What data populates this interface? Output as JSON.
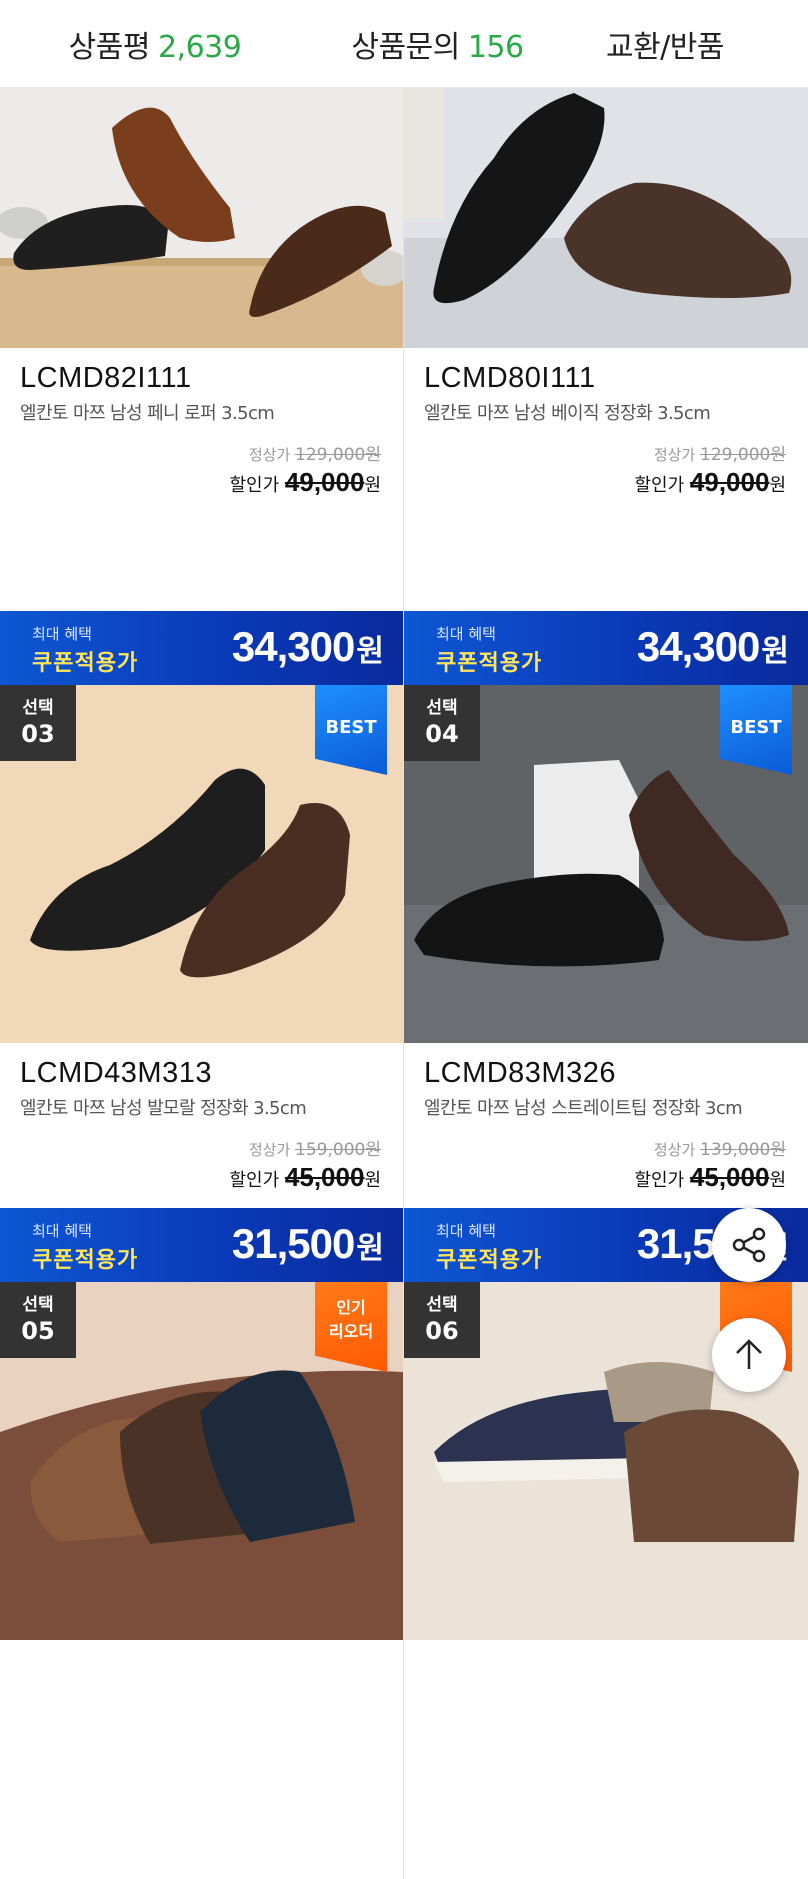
{
  "tabs": [
    {
      "label": "상품평",
      "count": "2,639"
    },
    {
      "label": "상품문의",
      "count": "156"
    },
    {
      "label": "교환/반품",
      "count": ""
    }
  ],
  "coupon_common": {
    "small": "최대 혜택",
    "label": "쿠폰적용가"
  },
  "products": [
    {
      "code": "LCMD82I111",
      "desc": "엘칸토 마쯔 남성 페니 로퍼 3.5cm",
      "orig_label": "정상가",
      "orig_price": "129,000",
      "orig_unit": "원",
      "sale_label": "할인가",
      "sale_price": "49,000",
      "sale_unit": "원",
      "coupon_price": "34,300",
      "coupon_unit": "원"
    },
    {
      "code": "LCMD80I111",
      "desc": "엘칸토 마쯔 남성 베이직 정장화 3.5cm",
      "orig_label": "정상가",
      "orig_price": "129,000",
      "orig_unit": "원",
      "sale_label": "할인가",
      "sale_price": "49,000",
      "sale_unit": "원",
      "coupon_price": "34,300",
      "coupon_unit": "원"
    },
    {
      "choice_label": "선택",
      "choice_num": "03",
      "badge": "BEST",
      "code": "LCMD43M313",
      "desc": "엘칸토 마쯔 남성 발모랄 정장화 3.5cm",
      "orig_label": "정상가",
      "orig_price": "159,000",
      "orig_unit": "원",
      "sale_label": "할인가",
      "sale_price": "45,000",
      "sale_unit": "원",
      "coupon_price": "31,500",
      "coupon_unit": "원"
    },
    {
      "choice_label": "선택",
      "choice_num": "04",
      "badge": "BEST",
      "code": "LCMD83M326",
      "desc": "엘칸토 마쯔 남성 스트레이트팁 정장화 3cm",
      "orig_label": "정상가",
      "orig_price": "139,000",
      "orig_unit": "원",
      "sale_label": "할인가",
      "sale_price": "45,000",
      "sale_unit": "원",
      "coupon_price": "31,500",
      "coupon_unit": "원"
    },
    {
      "choice_label": "선택",
      "choice_num": "05",
      "badge_line1": "인기",
      "badge_line2": "리오더"
    },
    {
      "choice_label": "선택",
      "choice_num": "06"
    }
  ],
  "fab": {
    "share_icon": "share-icon",
    "top_icon": "arrow-up-icon"
  }
}
